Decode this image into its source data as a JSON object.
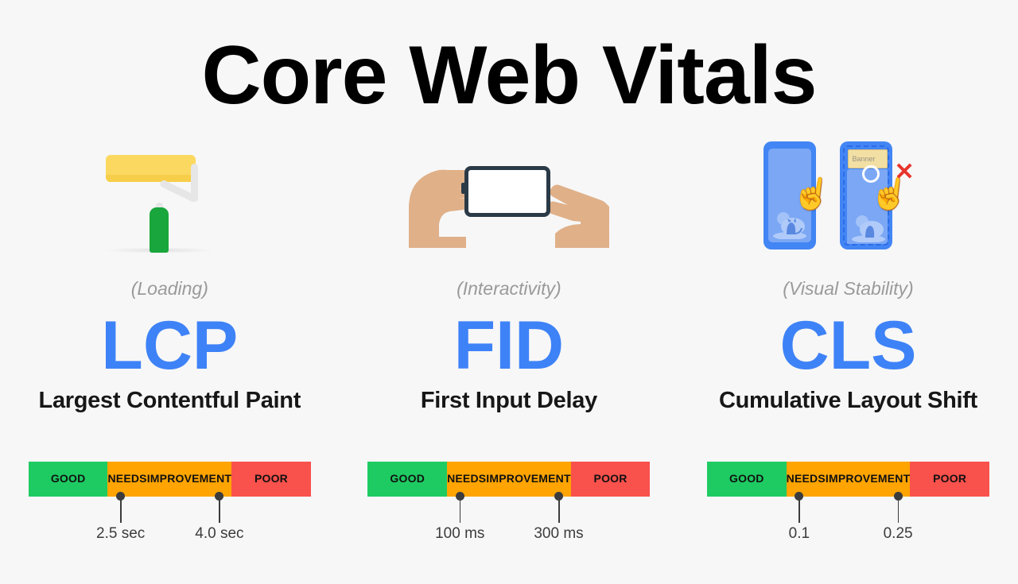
{
  "page": {
    "title": "Core Web Vitals",
    "background_color": "#F7F7F7"
  },
  "colors": {
    "accent_blue": "#3E82F7",
    "good": "#1ECB62",
    "needs_improvement": "#FFA400",
    "poor": "#F9514C",
    "pin": "#3C3C3C",
    "category_text": "#9A9A9A",
    "title_text": "#000000"
  },
  "metrics": [
    {
      "id": "lcp",
      "icon": "paint-roller-icon",
      "category": "(Loading)",
      "acronym": "LCP",
      "name": "Largest Contentful Paint",
      "scale": {
        "segments": [
          {
            "key": "good",
            "label": "GOOD",
            "color": "#1ECB62"
          },
          {
            "key": "needs",
            "label": "NEEDS\nIMPROVEMENT",
            "label_line1": "NEEDS",
            "label_line2": "IMPROVEMENT",
            "color": "#FFA400"
          },
          {
            "key": "poor",
            "label": "POOR",
            "color": "#F9514C"
          }
        ],
        "thresholds": [
          {
            "value": "2.5 sec",
            "position_pct": 32.5
          },
          {
            "value": "4.0 sec",
            "position_pct": 67.5
          }
        ]
      }
    },
    {
      "id": "fid",
      "icon": "hands-tapping-phone-icon",
      "category": "(Interactivity)",
      "acronym": "FID",
      "name": "First Input Delay",
      "scale": {
        "segments": [
          {
            "key": "good",
            "label": "GOOD",
            "color": "#1ECB62"
          },
          {
            "key": "needs",
            "label": "NEEDS\nIMPROVEMENT",
            "label_line1": "NEEDS",
            "label_line2": "IMPROVEMENT",
            "color": "#FFA400"
          },
          {
            "key": "poor",
            "label": "POOR",
            "color": "#F9514C"
          }
        ],
        "thresholds": [
          {
            "value": "100 ms",
            "position_pct": 32.5
          },
          {
            "value": "300 ms",
            "position_pct": 67.5
          }
        ]
      }
    },
    {
      "id": "cls",
      "icon": "shifting-layout-phones-icon",
      "category": "(Visual Stability)",
      "acronym": "CLS",
      "name": "Cumulative Layout Shift",
      "icon_details": {
        "banner_label": "Banner",
        "error_mark": "✕",
        "pointing_hand": "☝"
      },
      "scale": {
        "segments": [
          {
            "key": "good",
            "label": "GOOD",
            "color": "#1ECB62"
          },
          {
            "key": "needs",
            "label": "NEEDS\nIMPROVEMENT",
            "label_line1": "NEEDS",
            "label_line2": "IMPROVEMENT",
            "color": "#FFA400"
          },
          {
            "key": "poor",
            "label": "POOR",
            "color": "#F9514C"
          }
        ],
        "thresholds": [
          {
            "value": "0.1",
            "position_pct": 32.5
          },
          {
            "value": "0.25",
            "position_pct": 67.5
          }
        ]
      }
    }
  ]
}
